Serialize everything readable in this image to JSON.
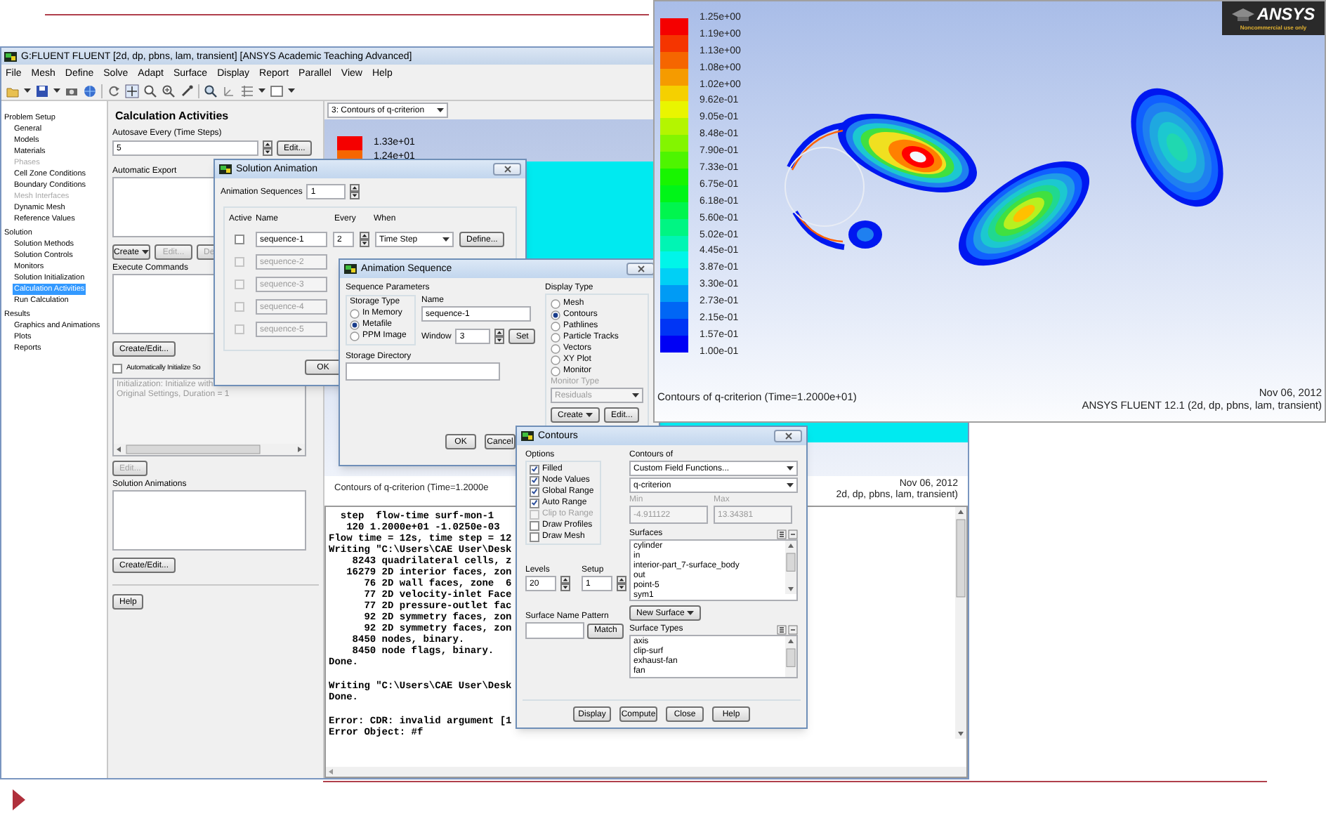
{
  "fluent_window": {
    "title": "G:FLUENT FLUENT  [2d, dp, pbns, lam, transient] [ANSYS Academic Teaching Advanced]",
    "menu": [
      "File",
      "Mesh",
      "Define",
      "Solve",
      "Adapt",
      "Surface",
      "Display",
      "Report",
      "Parallel",
      "View",
      "Help"
    ],
    "navigation": [
      {
        "title": "Problem Setup",
        "items": [
          {
            "label": "General",
            "selected": false,
            "disabled": false
          },
          {
            "label": "Models",
            "selected": false,
            "disabled": false
          },
          {
            "label": "Materials",
            "selected": false,
            "disabled": false
          },
          {
            "label": "Phases",
            "selected": false,
            "disabled": true
          },
          {
            "label": "Cell Zone Conditions",
            "selected": false,
            "disabled": false
          },
          {
            "label": "Boundary Conditions",
            "selected": false,
            "disabled": false
          },
          {
            "label": "Mesh Interfaces",
            "selected": false,
            "disabled": true
          },
          {
            "label": "Dynamic Mesh",
            "selected": false,
            "disabled": false
          },
          {
            "label": "Reference Values",
            "selected": false,
            "disabled": false
          }
        ]
      },
      {
        "title": "Solution",
        "items": [
          {
            "label": "Solution Methods",
            "selected": false,
            "disabled": false
          },
          {
            "label": "Solution Controls",
            "selected": false,
            "disabled": false
          },
          {
            "label": "Monitors",
            "selected": false,
            "disabled": false
          },
          {
            "label": "Solution Initialization",
            "selected": false,
            "disabled": false
          },
          {
            "label": "Calculation Activities",
            "selected": true,
            "disabled": false
          },
          {
            "label": "Run Calculation",
            "selected": false,
            "disabled": false
          }
        ]
      },
      {
        "title": "Results",
        "items": [
          {
            "label": "Graphics and Animations",
            "selected": false,
            "disabled": false
          },
          {
            "label": "Plots",
            "selected": false,
            "disabled": false
          },
          {
            "label": "Reports",
            "selected": false,
            "disabled": false
          }
        ]
      }
    ],
    "task_panel": {
      "title": "Calculation Activities",
      "autosave_label": "Autosave Every (Time Steps)",
      "autosave_value": "5",
      "autosave_button": "Edit...",
      "export_label": "Automatic Export",
      "export_buttons": [
        {
          "label": "Create",
          "dropdown": true,
          "disabled": false
        },
        {
          "label": "Edit...",
          "dropdown": false,
          "disabled": true
        },
        {
          "label": "De",
          "dropdown": false,
          "disabled": true
        }
      ],
      "commands_label": "Execute Commands",
      "commands_button": "Create/Edit...",
      "auto_init": {
        "label": "Automatically Initialize So",
        "checked": false
      },
      "init_text": [
        "Initialization: Initialize with",
        "Original Settings, Duration = 1"
      ],
      "init_button": {
        "label": "Edit...",
        "disabled": true
      },
      "animations_label": "Solution Animations",
      "animations_button": "Create/Edit...",
      "help_button": "Help"
    },
    "graphics": {
      "tab": "3: Contours of q-criterion",
      "legend": [
        "1.33e+01",
        "1.24e+01"
      ],
      "caption": "Contours of q-criterion  (Time=1.2000e",
      "date": "Nov 06, 2012",
      "version": "2d, dp, pbns, lam, transient)"
    },
    "console": {
      "blocks": [
        [
          "  step  flow-time surf-mon-1",
          "   120 1.2000e+01 -1.0250e-03",
          "Flow time = 12s, time step = 12",
          "Writing \"C:\\Users\\CAE User\\Desk",
          "    8243 quadrilateral cells, z",
          "   16279 2D interior faces, zon",
          "      76 2D wall faces, zone  6",
          "      77 2D velocity-inlet Face",
          "      77 2D pressure-outlet fac",
          "      92 2D symmetry faces, zon",
          "      92 2D symmetry faces, zon",
          "    8450 nodes, binary.",
          "    8450 node flags, binary.",
          "Done."
        ],
        [
          "Writing \"C:\\Users\\CAE User\\Desk",
          "Done."
        ],
        [
          "Error: CDR: invalid argument [1",
          "Error Object: #f"
        ]
      ]
    }
  },
  "solution_animation": {
    "title": "Solution Animation",
    "sequences_label": "Animation Sequences",
    "sequences_value": "1",
    "columns": [
      "Active",
      "Name",
      "Every",
      "When"
    ],
    "rows": [
      {
        "active": false,
        "disabled": false,
        "name": "sequence-1",
        "every": "2",
        "when": "Time Step",
        "button": "Define..."
      },
      {
        "active": false,
        "disabled": true,
        "name": "sequence-2"
      },
      {
        "active": false,
        "disabled": true,
        "name": "sequence-3"
      },
      {
        "active": false,
        "disabled": true,
        "name": "sequence-4"
      },
      {
        "active": false,
        "disabled": true,
        "name": "sequence-5"
      }
    ],
    "ok_button": "OK"
  },
  "animation_sequence": {
    "title": "Animation Sequence",
    "parameters_label": "Sequence Parameters",
    "storage_label": "Storage Type",
    "storage_options": [
      {
        "label": "In Memory",
        "selected": false
      },
      {
        "label": "Metafile",
        "selected": true
      },
      {
        "label": "PPM Image",
        "selected": false
      }
    ],
    "name_label": "Name",
    "name_value": "sequence-1",
    "window_label": "Window",
    "window_value": "3",
    "set_button": "Set",
    "directory_label": "Storage Directory",
    "display_label": "Display Type",
    "display_options": [
      {
        "label": "Mesh",
        "selected": false
      },
      {
        "label": "Contours",
        "selected": true
      },
      {
        "label": "Pathlines",
        "selected": false
      },
      {
        "label": "Particle Tracks",
        "selected": false
      },
      {
        "label": "Vectors",
        "selected": false
      },
      {
        "label": "XY Plot",
        "selected": false
      },
      {
        "label": "Monitor",
        "selected": false
      }
    ],
    "monitor_label": "Monitor Type",
    "monitor_value": "Residuals",
    "monitor_disabled": true,
    "create_button": "Create",
    "edit_button": "Edit...",
    "buttons": [
      "OK",
      "Cancel"
    ]
  },
  "contours": {
    "title": "Contours",
    "options_label": "Options",
    "options": [
      {
        "label": "Filled",
        "checked": true,
        "disabled": false
      },
      {
        "label": "Node Values",
        "checked": true,
        "disabled": false
      },
      {
        "label": "Global Range",
        "checked": true,
        "disabled": false
      },
      {
        "label": "Auto Range",
        "checked": true,
        "disabled": false
      },
      {
        "label": "Clip to Range",
        "checked": false,
        "disabled": true
      },
      {
        "label": "Draw Profiles",
        "checked": false,
        "disabled": false
      },
      {
        "label": "Draw Mesh",
        "checked": false,
        "disabled": false
      }
    ],
    "contours_of_label": "Contours of",
    "category": "Custom Field Functions...",
    "field": "q-criterion",
    "min_label": "Min",
    "min_value": "-4.911122",
    "max_label": "Max",
    "max_value": "13.34381",
    "range_disabled": true,
    "surfaces_label": "Surfaces",
    "surfaces": [
      "cylinder",
      "in",
      "interior-part_7-surface_body",
      "out",
      "point-5",
      "sym1"
    ],
    "levels_label": "Levels",
    "levels_value": "20",
    "setup_label": "Setup",
    "setup_value": "1",
    "pattern_label": "Surface Name Pattern",
    "match_button": "Match",
    "new_surface_button": "New Surface",
    "surface_types_label": "Surface Types",
    "surface_types": [
      "axis",
      "clip-surf",
      "exhaust-fan",
      "fan"
    ],
    "buttons": [
      "Display",
      "Compute",
      "Close",
      "Help"
    ]
  },
  "result_image": {
    "logo": "ANSYS",
    "logo_note": "Noncommercial use only",
    "legend": [
      "1.25e+00",
      "1.19e+00",
      "1.13e+00",
      "1.08e+00",
      "1.02e+00",
      "9.62e-01",
      "9.05e-01",
      "8.48e-01",
      "7.90e-01",
      "7.33e-01",
      "6.75e-01",
      "6.18e-01",
      "5.60e-01",
      "5.02e-01",
      "4.45e-01",
      "3.87e-01",
      "3.30e-01",
      "2.73e-01",
      "2.15e-01",
      "1.57e-01",
      "1.00e-01"
    ],
    "caption": "Contours of q-criterion  (Time=1.2000e+01)",
    "date": "Nov 06, 2012",
    "version": "ANSYS FLUENT 12.1 (2d, dp, pbns, lam, transient)"
  }
}
